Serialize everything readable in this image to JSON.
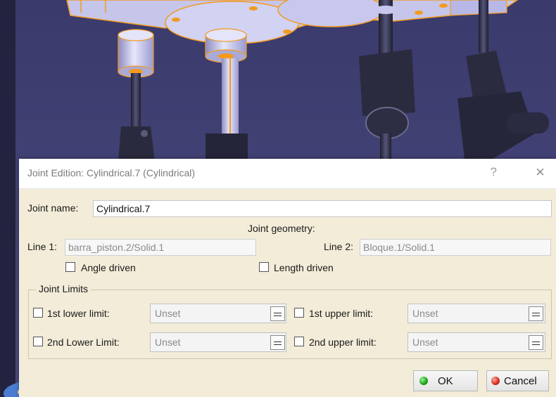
{
  "dialog": {
    "title": "Joint Edition: Cylindrical.7 (Cylindrical)",
    "help_glyph": "?",
    "close_glyph": "×",
    "joint_name_label": "Joint name:",
    "joint_name_value": "Cylindrical.7",
    "joint_geometry_label": "Joint geometry:",
    "line1_label": "Line 1:",
    "line1_value": "barra_piston.2/Solid.1",
    "line2_label": "Line 2:",
    "line2_value": "Bloque.1/Solid.1",
    "angle_driven_label": "Angle driven",
    "length_driven_label": "Length driven",
    "joint_limits_label": "Joint Limits",
    "limits": {
      "first_lower_label": "1st lower limit:",
      "first_lower_value": "Unset",
      "first_upper_label": "1st upper limit:",
      "first_upper_value": "Unset",
      "second_lower_label": "2nd Lower Limit:",
      "second_lower_value": "Unset",
      "second_upper_label": "2nd upper limit:",
      "second_upper_value": "Unset"
    },
    "ok_label": "OK",
    "cancel_label": "Cancel"
  },
  "colors": {
    "viewport_bg": "#3f3f74",
    "dialog_bg": "#f3ecd9",
    "part_highlight": "#f39a1e",
    "part_fill": "#c9c9ea",
    "rod": "#2d2d44"
  },
  "icons": [
    "help-icon",
    "close-icon",
    "ok-status-icon",
    "cancel-status-icon",
    "spin-icon"
  ]
}
